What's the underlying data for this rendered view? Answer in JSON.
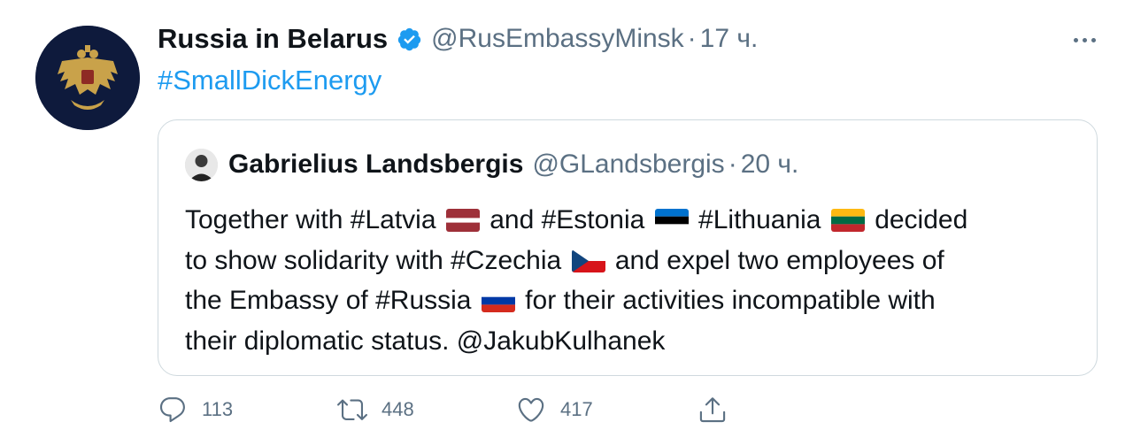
{
  "tweet": {
    "author_name": "Russia in Belarus",
    "author_handle": "@RusEmbassyMinsk",
    "separator": "·",
    "time": "17 ч.",
    "text": "#SmallDickEnergy"
  },
  "quoted": {
    "author_name": "Gabrielius Landsbergis",
    "author_handle": "@GLandsbergis",
    "separator": "·",
    "time": "20 ч.",
    "body": {
      "l1_a": "Together with #Latvia",
      "l1_b": "and #Estonia",
      "l1_c": "#Lithuania",
      "l1_d": "decided",
      "l2_a": "to show solidarity with #Czechia",
      "l2_b": "and expel two employees of",
      "l3_a": "the Embassy of #Russia",
      "l3_b": "for their activities incompatible with",
      "l4": "their diplomatic status. @JakubKulhanek"
    }
  },
  "actions": {
    "reply_count": "113",
    "retweet_count": "448",
    "like_count": "417"
  },
  "colors": {
    "link_blue": "#1d9bf0",
    "secondary_text": "#5b7083",
    "avatar_bg": "#0e1a3c",
    "emblem_gold": "#c9a24a"
  }
}
